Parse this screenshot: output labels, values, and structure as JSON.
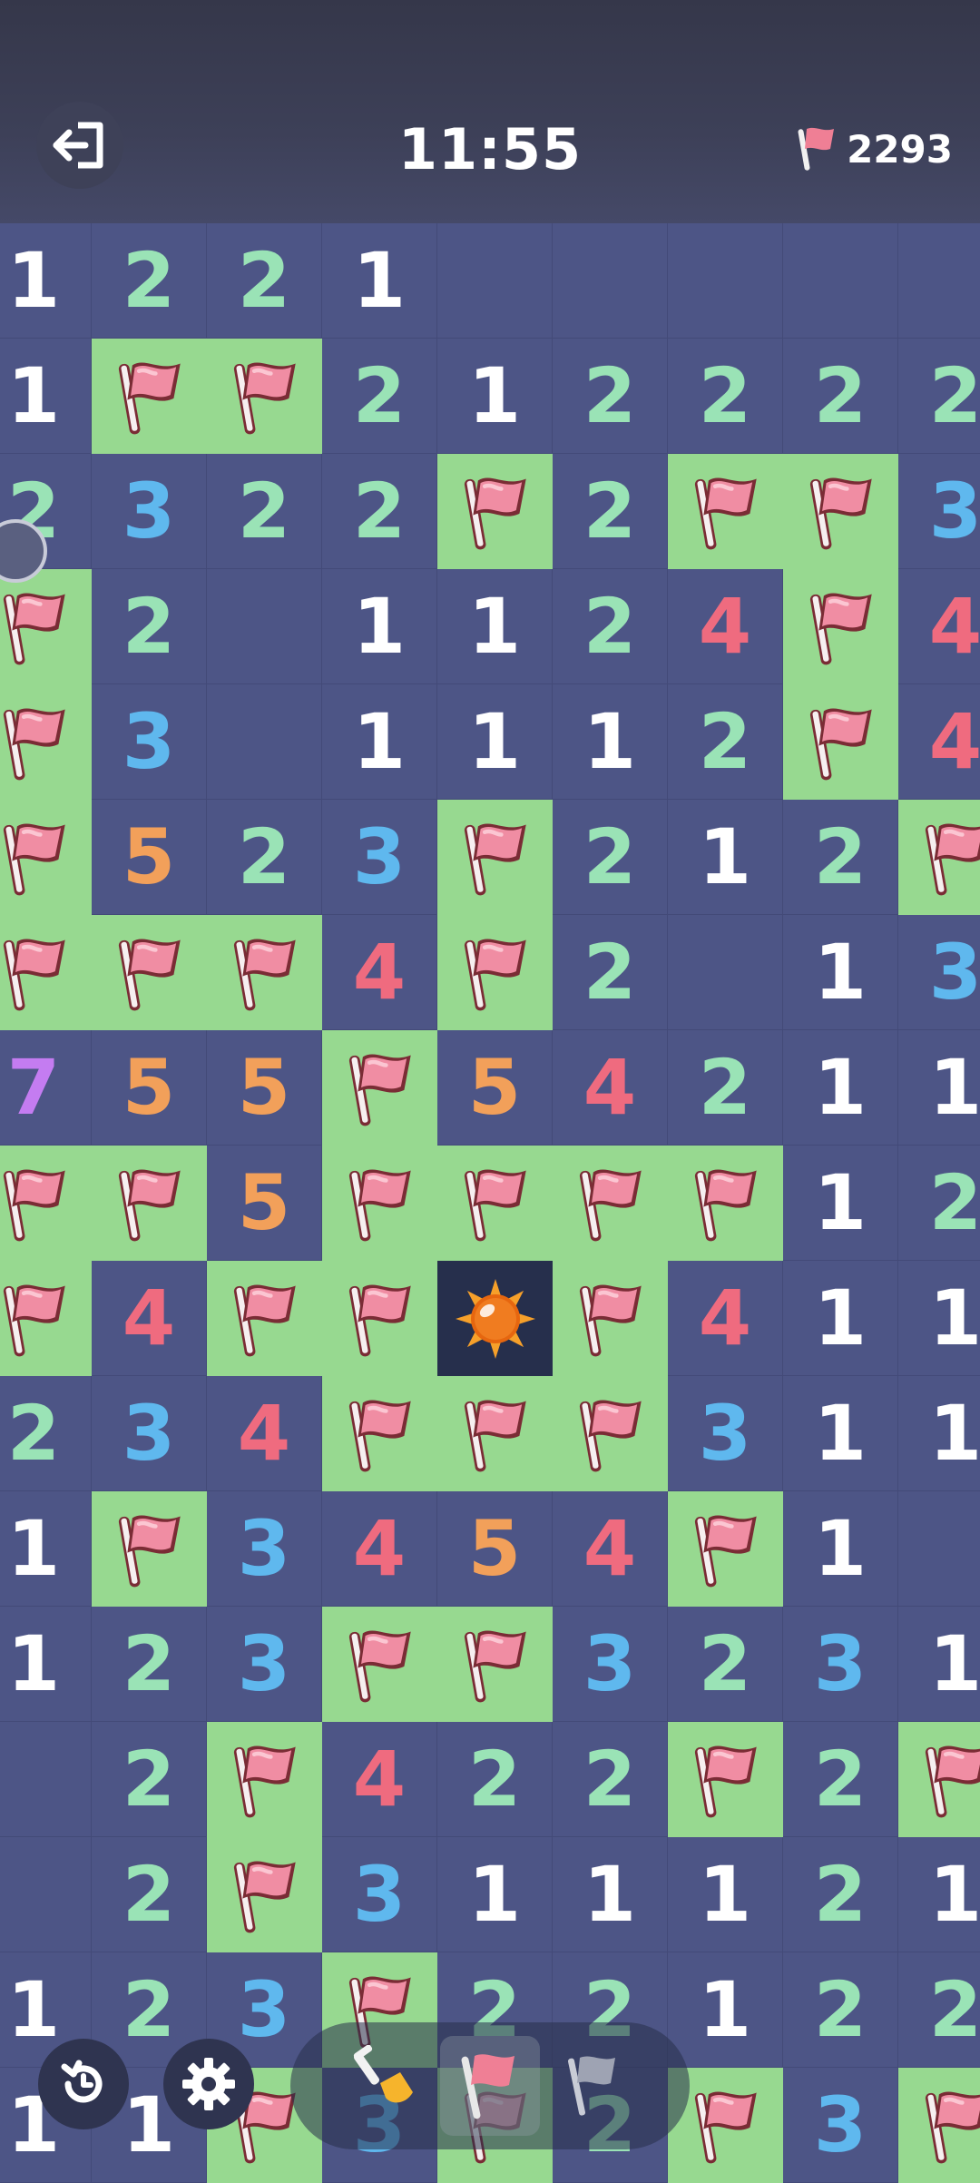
{
  "header": {
    "timer": "11:55",
    "flag_score": "2293"
  },
  "colors": {
    "unrevealed": "#4d5586",
    "flagged": "#97d990",
    "selected": "#262f4c",
    "n1": "#ffffff",
    "n2": "#9ae3b6",
    "n3": "#5fb8ee",
    "n4": "#ef6b7f",
    "n5": "#f2a05a",
    "n7": "#c47cf1"
  },
  "board": {
    "rows": [
      [
        "1",
        "2",
        "2",
        "1",
        "",
        "",
        "",
        "",
        ""
      ],
      [
        "1",
        "F",
        "F",
        "2",
        "1",
        "2",
        "2",
        "2",
        "2"
      ],
      [
        "2",
        "3",
        "2",
        "2",
        "F",
        "2",
        "F",
        "F",
        "3"
      ],
      [
        "F",
        "2",
        "",
        "1",
        "1",
        "2",
        "4",
        "F",
        "4"
      ],
      [
        "F",
        "3",
        "",
        "1",
        "1",
        "1",
        "2",
        "F",
        "4"
      ],
      [
        "F",
        "5",
        "2",
        "3",
        "F",
        "2",
        "1",
        "2",
        "F"
      ],
      [
        "F",
        "F",
        "F",
        "4",
        "F",
        "2",
        "",
        "1",
        "3"
      ],
      [
        "7",
        "5",
        "5",
        "F",
        "5",
        "4",
        "2",
        "1",
        "1"
      ],
      [
        "F",
        "F",
        "5",
        "F",
        "F",
        "F",
        "F",
        "1",
        "2"
      ],
      [
        "F",
        "4",
        "F",
        "F",
        "S",
        "F",
        "4",
        "1",
        "1"
      ],
      [
        "2",
        "3",
        "4",
        "F",
        "F",
        "F",
        "3",
        "1",
        "1"
      ],
      [
        "1",
        "F",
        "3",
        "4",
        "5",
        "4",
        "F",
        "1",
        ""
      ],
      [
        "1",
        "2",
        "3",
        "F",
        "F",
        "3",
        "2",
        "3",
        "1"
      ],
      [
        "",
        "2",
        "F",
        "4",
        "2",
        "2",
        "F",
        "2",
        "F"
      ],
      [
        "",
        "2",
        "F",
        "3",
        "1",
        "1",
        "1",
        "2",
        "1"
      ],
      [
        "1",
        "2",
        "3",
        "F",
        "2",
        "2",
        "1",
        "2",
        "2"
      ],
      [
        "1",
        "1",
        "F",
        "3",
        "F",
        "2",
        "F",
        "3",
        "F"
      ]
    ]
  },
  "toolbar": {
    "icons": [
      "undo-icon",
      "settings-icon",
      "shovel-icon",
      "flag-icon",
      "flag-outline-icon"
    ]
  }
}
